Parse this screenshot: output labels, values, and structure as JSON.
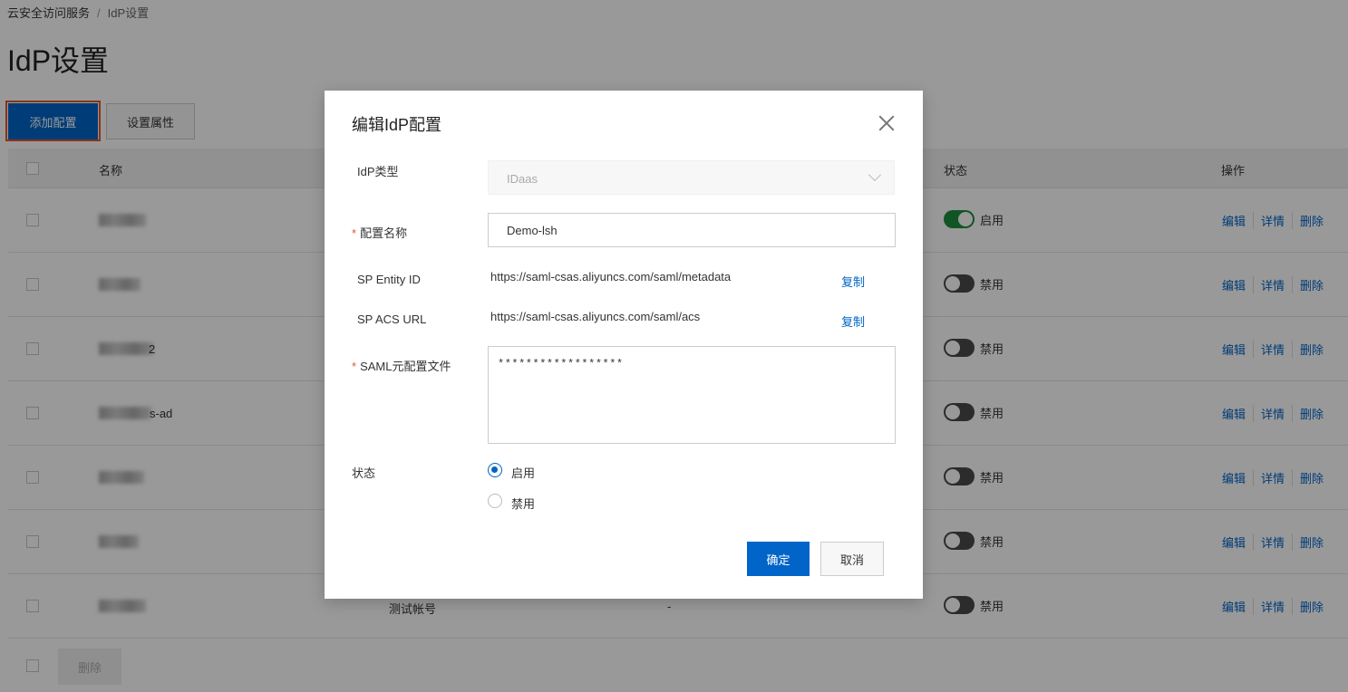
{
  "breadcrumb": {
    "root": "云安全访问服务",
    "separator": "/",
    "current": "IdP设置"
  },
  "page_title": "IdP设置",
  "toolbar": {
    "add_label": "添加配置",
    "settings_label": "设置属性"
  },
  "table": {
    "columns": {
      "name": "名称",
      "status": "状态",
      "actions": "操作"
    },
    "rows": [
      {
        "name_suffix": "",
        "status": "启用",
        "enabled": true
      },
      {
        "name_suffix": "",
        "status": "禁用",
        "enabled": false
      },
      {
        "name_suffix": "2",
        "status": "禁用",
        "enabled": false
      },
      {
        "name_suffix": "s-ad",
        "status": "禁用",
        "enabled": false
      },
      {
        "name_suffix": "",
        "status": "禁用",
        "enabled": false
      },
      {
        "name_suffix": "",
        "status": "禁用",
        "enabled": false
      },
      {
        "name_suffix": "",
        "description": "测试帐号",
        "extra": "-",
        "status": "禁用",
        "enabled": false
      }
    ],
    "actions": {
      "edit": "编辑",
      "detail": "详情",
      "delete": "删除"
    },
    "footer_delete": "删除"
  },
  "dialog": {
    "title": "编辑IdP配置",
    "idp_type": {
      "label": "IdP类型",
      "value": "IDaas"
    },
    "config_name": {
      "required_mark": "*",
      "label": "配置名称",
      "value": "Demo-lsh"
    },
    "sp_entity_id": {
      "label": "SP Entity ID",
      "value": "https://saml-csas.aliyuncs.com/saml/metadata",
      "copy": "复制"
    },
    "sp_acs_url": {
      "label": "SP ACS URL",
      "value": "https://saml-csas.aliyuncs.com/saml/acs",
      "copy": "复制"
    },
    "saml_metadata": {
      "required_mark": "*",
      "label": "SAML元配置文件",
      "value": "******************"
    },
    "status": {
      "label": "状态",
      "options": [
        "启用",
        "禁用"
      ],
      "selected": "启用"
    },
    "confirm": "确定",
    "cancel": "取消"
  }
}
